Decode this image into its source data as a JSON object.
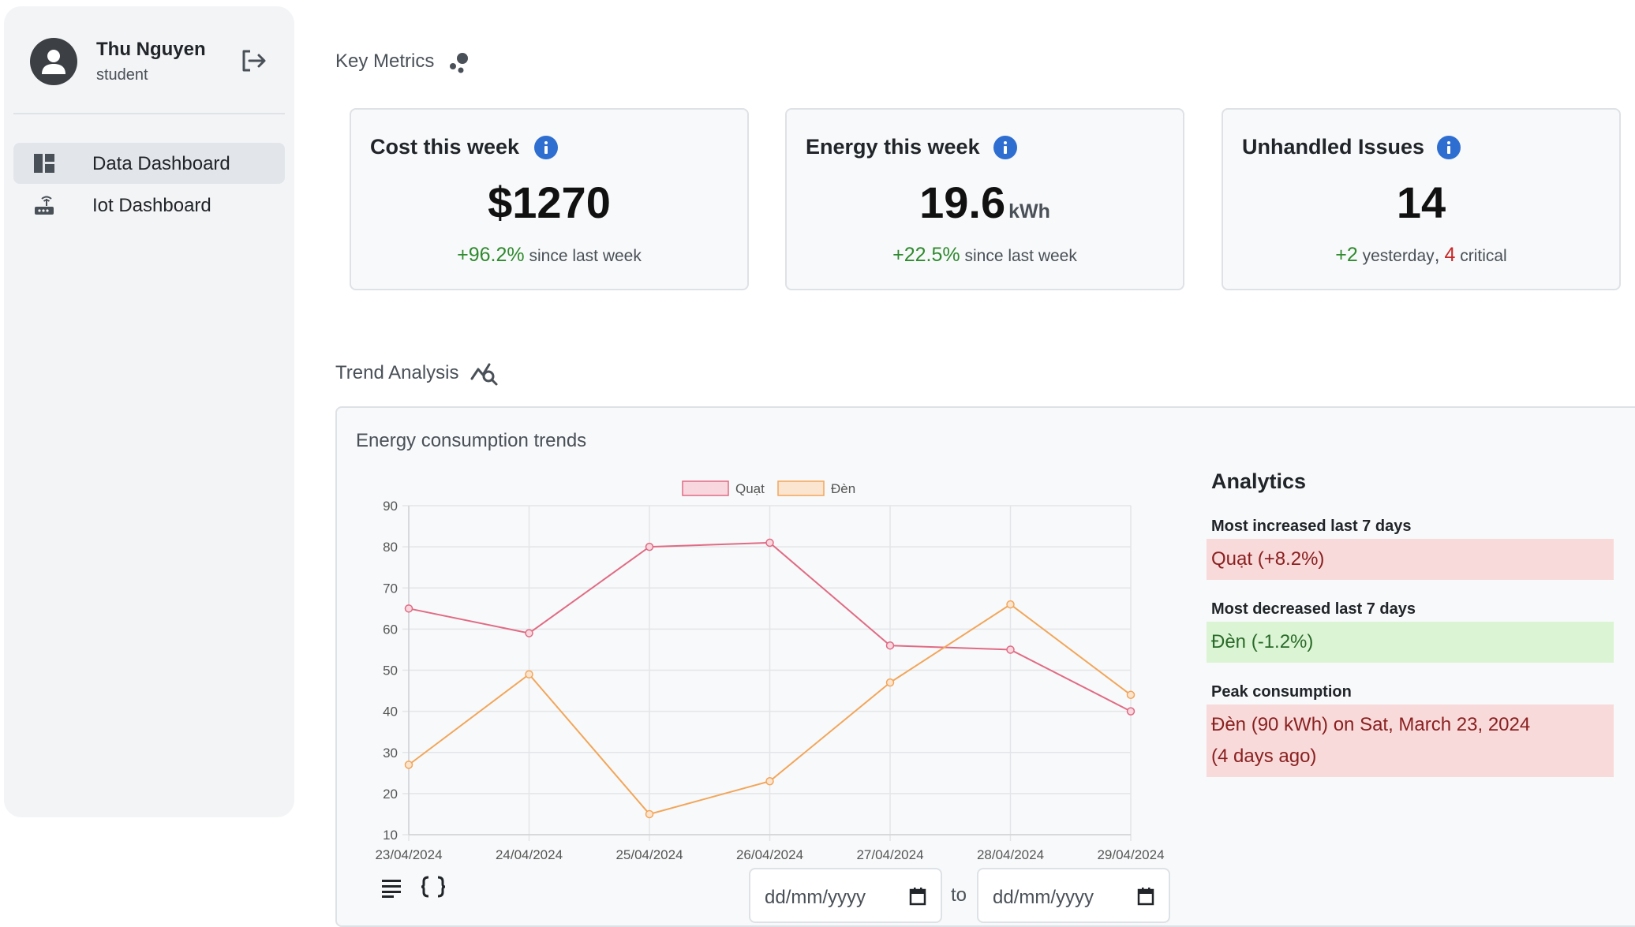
{
  "user": {
    "name": "Thu Nguyen",
    "role": "student"
  },
  "sidebar": {
    "items": [
      {
        "label": "Data Dashboard",
        "active": true,
        "icon": "dashboard-icon"
      },
      {
        "label": "Iot Dashboard",
        "active": false,
        "icon": "router-icon"
      }
    ]
  },
  "key_metrics": {
    "title": "Key Metrics",
    "cards": [
      {
        "title": "Cost this week",
        "value": "$1270",
        "unit": "",
        "change": "+96.2%",
        "change_text": "since last week"
      },
      {
        "title": "Energy this week",
        "value": "19.6",
        "unit": "kWh",
        "change": "+22.5%",
        "change_text": "since last week"
      },
      {
        "title": "Unhandled Issues",
        "value": "14",
        "unit": "",
        "yesterday_count": "+2",
        "yesterday_text": "yesterday",
        "separator": ",",
        "critical_count": "4",
        "critical_text": "critical"
      }
    ]
  },
  "trend": {
    "title": "Trend Analysis",
    "panel_title": "Energy consumption trends",
    "date_placeholder": "dd/mm/yyyy",
    "to_label": "to"
  },
  "analytics": {
    "title": "Analytics",
    "most_increased_label": "Most increased last 7 days",
    "most_increased_value": "Quạt (+8.2%)",
    "most_decreased_label": "Most decreased last 7 days",
    "most_decreased_value": "Đèn (-1.2%)",
    "peak_label": "Peak consumption",
    "peak_value_line1": "Đèn (90 kWh) on Sat, March 23, 2024",
    "peak_value_line2": "(4 days ago)"
  },
  "colors": {
    "quat": "#e06b84",
    "den": "#f2a65a",
    "accent": "#2f6ed1"
  },
  "chart_data": {
    "type": "line",
    "categories": [
      "23/04/2024",
      "24/04/2024",
      "25/04/2024",
      "26/04/2024",
      "27/04/2024",
      "28/04/2024",
      "29/04/2024"
    ],
    "ylim": [
      10,
      90
    ],
    "yticks": [
      10,
      20,
      30,
      40,
      50,
      60,
      70,
      80,
      90
    ],
    "grid": true,
    "legend_position": "top",
    "series": [
      {
        "name": "Quạt",
        "values": [
          65,
          59,
          80,
          81,
          56,
          55,
          40
        ]
      },
      {
        "name": "Đèn",
        "values": [
          27,
          49,
          15,
          23,
          47,
          66,
          44
        ]
      }
    ]
  }
}
